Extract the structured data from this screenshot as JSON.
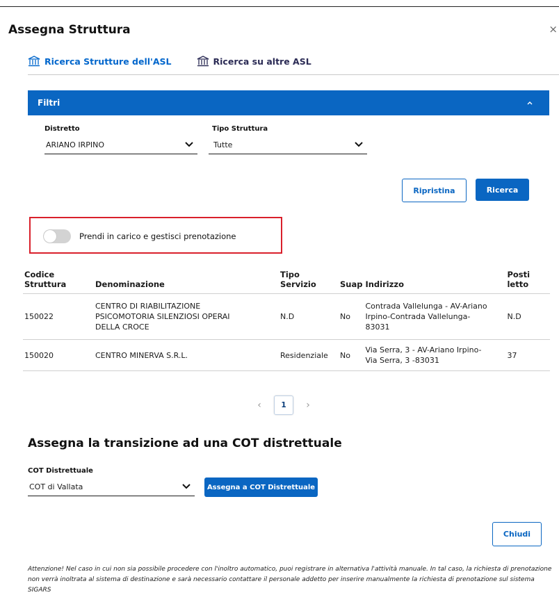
{
  "dialog": {
    "title": "Assegna Struttura",
    "close_glyph": "×"
  },
  "tabs": [
    {
      "label": "Ricerca Strutture dell'ASL",
      "icon": "institution-icon"
    },
    {
      "label": "Ricerca su altre ASL",
      "icon": "institution-icon"
    }
  ],
  "filters": {
    "title": "Filtri",
    "distretto": {
      "label": "Distretto",
      "value": "ARIANO IRPINO"
    },
    "tipo_struttura": {
      "label": "Tipo Struttura",
      "value": "Tutte"
    },
    "reset_label": "Ripristina",
    "search_label": "Ricerca"
  },
  "toggle": {
    "label": "Prendi in carico e gestisci prenotazione",
    "on": false
  },
  "table": {
    "headers": {
      "codice_1": "Codice",
      "codice_2": "Struttura",
      "denominazione": "Denominazione",
      "tipo_1": "Tipo",
      "tipo_2": "Servizio",
      "suap": "Suap",
      "indirizzo": "Indirizzo",
      "posti_1": "Posti",
      "posti_2": "letto"
    },
    "rows": [
      {
        "codice": "150022",
        "denominazione_lines": [
          "CENTRO DI RIABILITAZIONE",
          "PSICOMOTORIA SILENZIOSI OPERAI",
          "DELLA CROCE"
        ],
        "tipo": "N.D",
        "suap": "No",
        "indirizzo_lines": [
          "Contrada Vallelunga - AV-Ariano",
          "Irpino-Contrada Vallelunga-",
          "83031"
        ],
        "posti": "N.D"
      },
      {
        "codice": "150020",
        "denominazione_lines": [
          "CENTRO MINERVA S.R.L."
        ],
        "tipo": "Residenziale",
        "suap": "No",
        "indirizzo_lines": [
          "Via Serra, 3 - AV-Ariano Irpino-",
          "Via Serra, 3 -83031"
        ],
        "posti": "37"
      }
    ]
  },
  "pagination": {
    "current_page": "1",
    "prev": "‹",
    "next": "›"
  },
  "cot": {
    "section_title": "Assegna la transizione ad una COT distrettuale",
    "field_label": "COT Distrettuale",
    "value": "COT di Vallata",
    "assign_label": "Assegna a COT Distrettuale"
  },
  "close_button_label": "Chiudi",
  "footer_note": "Attenzione! Nel caso in cui non sia possibile procedere con l'inoltro automatico, puoi registrare in alternativa l'attività manuale. In tal caso, la richiesta di prenotazione non verrà inoltrata al sistema di destinazione e sarà necessario contattare il personale addetto per inserire manualmente la richiesta di prenotazione sul sistema SIGARS",
  "colors": {
    "primary": "#0a66c2",
    "highlight": "#d9202b"
  }
}
